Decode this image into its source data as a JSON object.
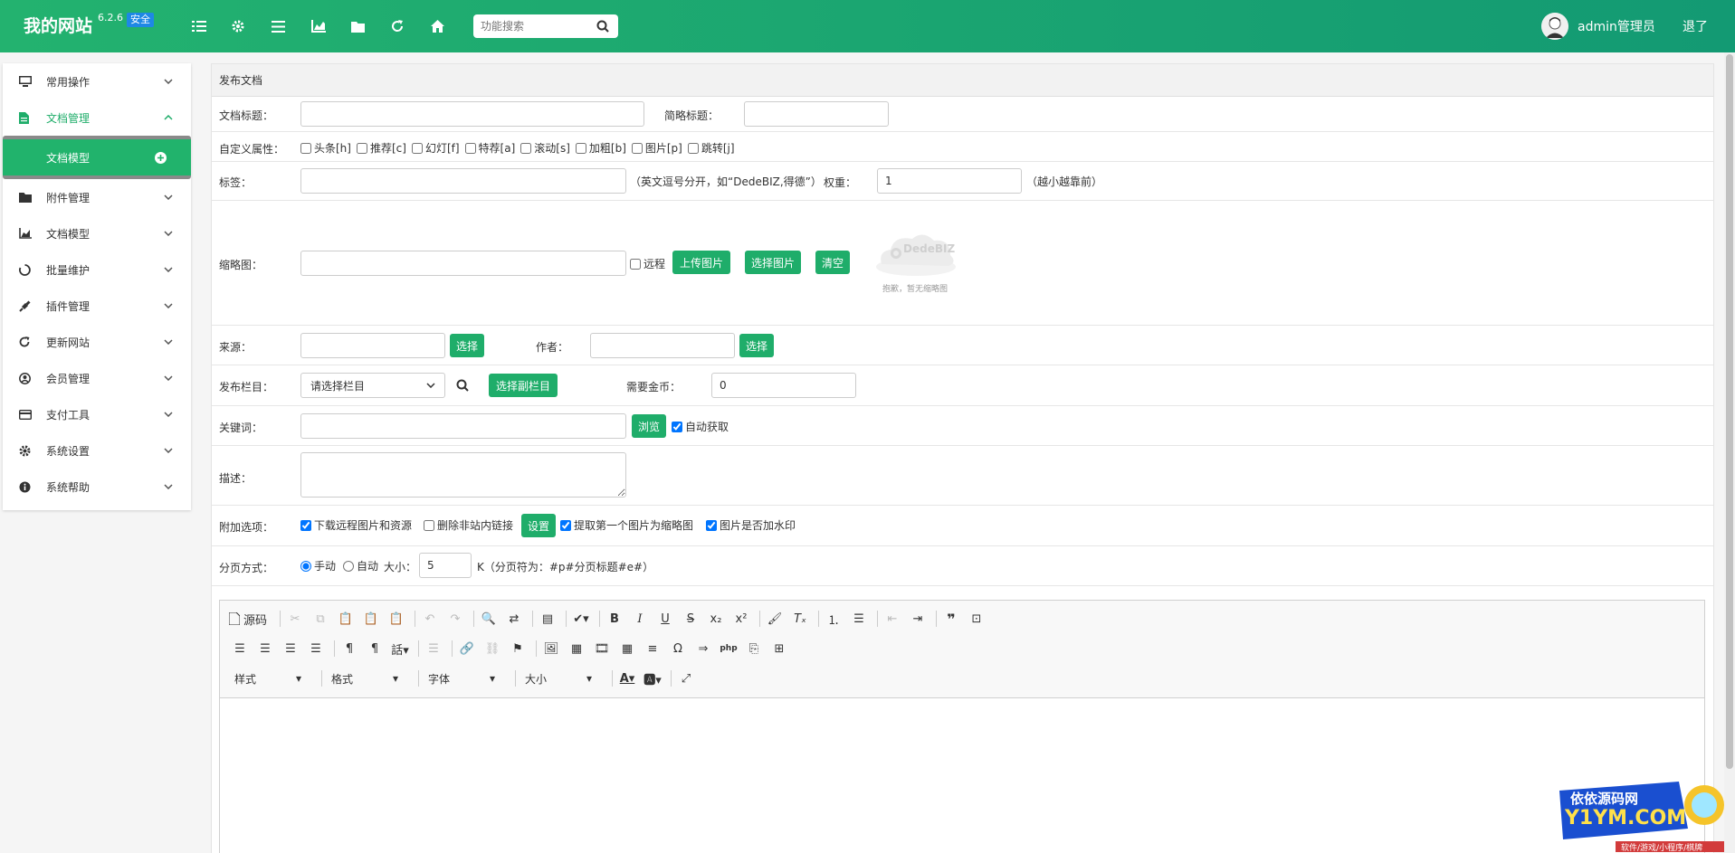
{
  "header": {
    "brand": "我的网站",
    "version": "6.2.6",
    "badge": "安全",
    "search_placeholder": "功能搜索",
    "user_name": "admin管理员",
    "logout": "退了",
    "icons": [
      "list-icon",
      "gear-icon",
      "menu-icon",
      "chart-icon",
      "folder-icon",
      "refresh-icon",
      "home-icon"
    ]
  },
  "sidebar": {
    "items": [
      {
        "label": "常用操作",
        "icon": "monitor-icon"
      },
      {
        "label": "文档管理",
        "icon": "file-icon"
      },
      {
        "label": "附件管理",
        "icon": "folder-icon"
      },
      {
        "label": "文档模型",
        "icon": "chart-icon"
      },
      {
        "label": "批量维护",
        "icon": "circle-icon"
      },
      {
        "label": "插件管理",
        "icon": "plug-icon"
      },
      {
        "label": "更新网站",
        "icon": "refresh-icon"
      },
      {
        "label": "会员管理",
        "icon": "user-icon"
      },
      {
        "label": "支付工具",
        "icon": "card-icon"
      },
      {
        "label": "系统设置",
        "icon": "gear-icon"
      },
      {
        "label": "系统帮助",
        "icon": "info-icon"
      }
    ],
    "subitem": "文档模型"
  },
  "form": {
    "header": "发布文档",
    "title_label": "文档标题：",
    "title_value": "",
    "short_title_label": "简略标题：",
    "short_title_value": "",
    "attrs_label": "自定义属性：",
    "attrs": [
      "头条[h]",
      "推荐[c]",
      "幻灯[f]",
      "特荐[a]",
      "滚动[s]",
      "加粗[b]",
      "图片[p]",
      "跳转[j]"
    ],
    "tags_label": "标签：",
    "tags_value": "",
    "tags_hint": "（英文逗号分开，如“DedeBIZ,得德”）",
    "weight_label": "权重：",
    "weight_value": "1",
    "weight_hint": "（越小越靠前）",
    "thumb_label": "缩略图：",
    "thumb_value": "",
    "remote_label": "远程",
    "upload_btn": "上传图片",
    "choose_btn": "选择图片",
    "clear_btn": "清空",
    "thumb_logo": "DedeBIZ",
    "thumb_caption": "抱歉，暂无缩略图",
    "source_label": "来源：",
    "source_value": "",
    "select_btn": "选择",
    "author_label": "作者：",
    "author_value": "",
    "category_label": "发布栏目：",
    "category_value": "请选择栏目",
    "sub_category_btn": "选择副栏目",
    "gold_label": "需要金币：",
    "gold_value": "0",
    "keywords_label": "关键词：",
    "keywords_value": "",
    "browse_btn": "浏览",
    "auto_get_label": "自动获取",
    "desc_label": "描述：",
    "desc_value": "",
    "extra_label": "附加选项：",
    "extra_download": "下载远程图片和资源",
    "extra_remove_links": "删除非站内链接",
    "settings_btn": "设置",
    "extra_first_image": "提取第一个图片为缩略图",
    "extra_watermark": "图片是否加水印",
    "paging_label": "分页方式：",
    "paging_manual": "手动",
    "paging_auto": "自动",
    "size_label": "大小：",
    "size_value": "5",
    "size_hint": "K（分页符为：#p#分页标题#e#）"
  },
  "editor": {
    "source_btn": "源码",
    "style_combo": "样式",
    "format_combo": "格式",
    "font_combo": "字体",
    "size_combo": "大小"
  },
  "watermark": {
    "line1": "依依源码网",
    "line2": "Y1YM.COM",
    "line3": "软件/游戏/小程序/棋牌"
  },
  "colors": {
    "primary": "#1fad6a",
    "header_start": "#23b26f",
    "header_end": "#139a73",
    "badge": "#1e88e5"
  }
}
